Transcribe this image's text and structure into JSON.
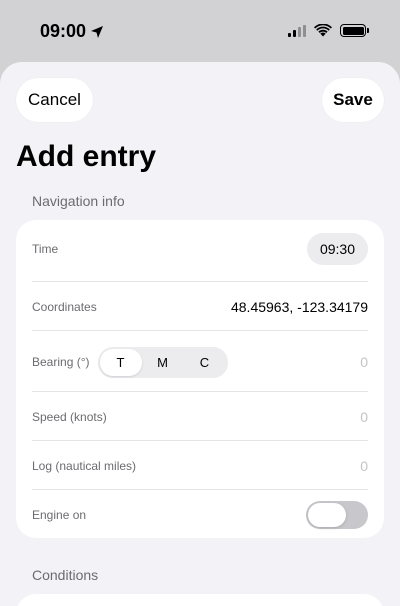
{
  "status_bar": {
    "time": "09:00",
    "location_icon": "location-arrow-icon",
    "signal_icon": "signal-icon",
    "wifi_icon": "wifi-icon",
    "battery_icon": "battery-icon"
  },
  "header": {
    "cancel_label": "Cancel",
    "save_label": "Save",
    "title": "Add entry"
  },
  "navigation_section": {
    "header": "Navigation info",
    "time": {
      "label": "Time",
      "value": "09:30"
    },
    "coordinates": {
      "label": "Coordinates",
      "value": "48.45963, -123.34179"
    },
    "bearing": {
      "label": "Bearing (°)",
      "options": [
        "T",
        "M",
        "C"
      ],
      "selected": "T",
      "placeholder": "0"
    },
    "speed": {
      "label": "Speed (knots)",
      "placeholder": "0"
    },
    "log": {
      "label": "Log (nautical miles)",
      "placeholder": "0"
    },
    "engine": {
      "label": "Engine on",
      "value": false
    }
  },
  "conditions_section": {
    "header": "Conditions"
  },
  "colors": {
    "sheet_bg": "#f2f2f7",
    "card_bg": "#ffffff",
    "label": "#6c6c70",
    "placeholder": "#c4c4c8",
    "toggle_off": "#c7c7cc"
  }
}
